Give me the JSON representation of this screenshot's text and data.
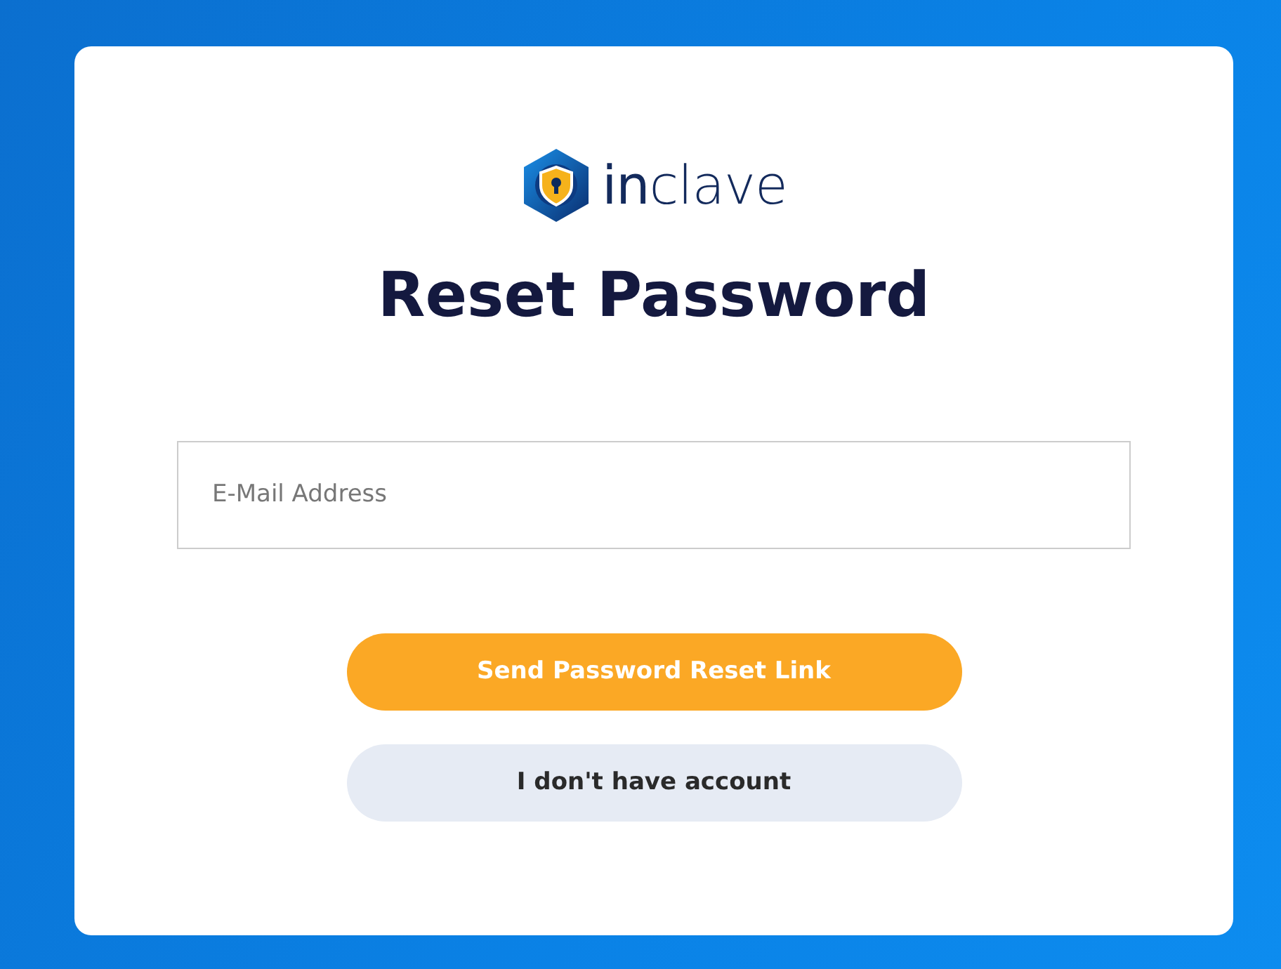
{
  "logo": {
    "text": "**in**clave"
  },
  "title": "Reset Password",
  "email_field": {
    "placeholder": "E-Mail Address"
  },
  "buttons": [
    {
      "label": "Send Password Reset Link",
      "kind": "primary"
    },
    {
      "label": "I don't have account",
      "kind": "secondary"
    }
  ]
}
